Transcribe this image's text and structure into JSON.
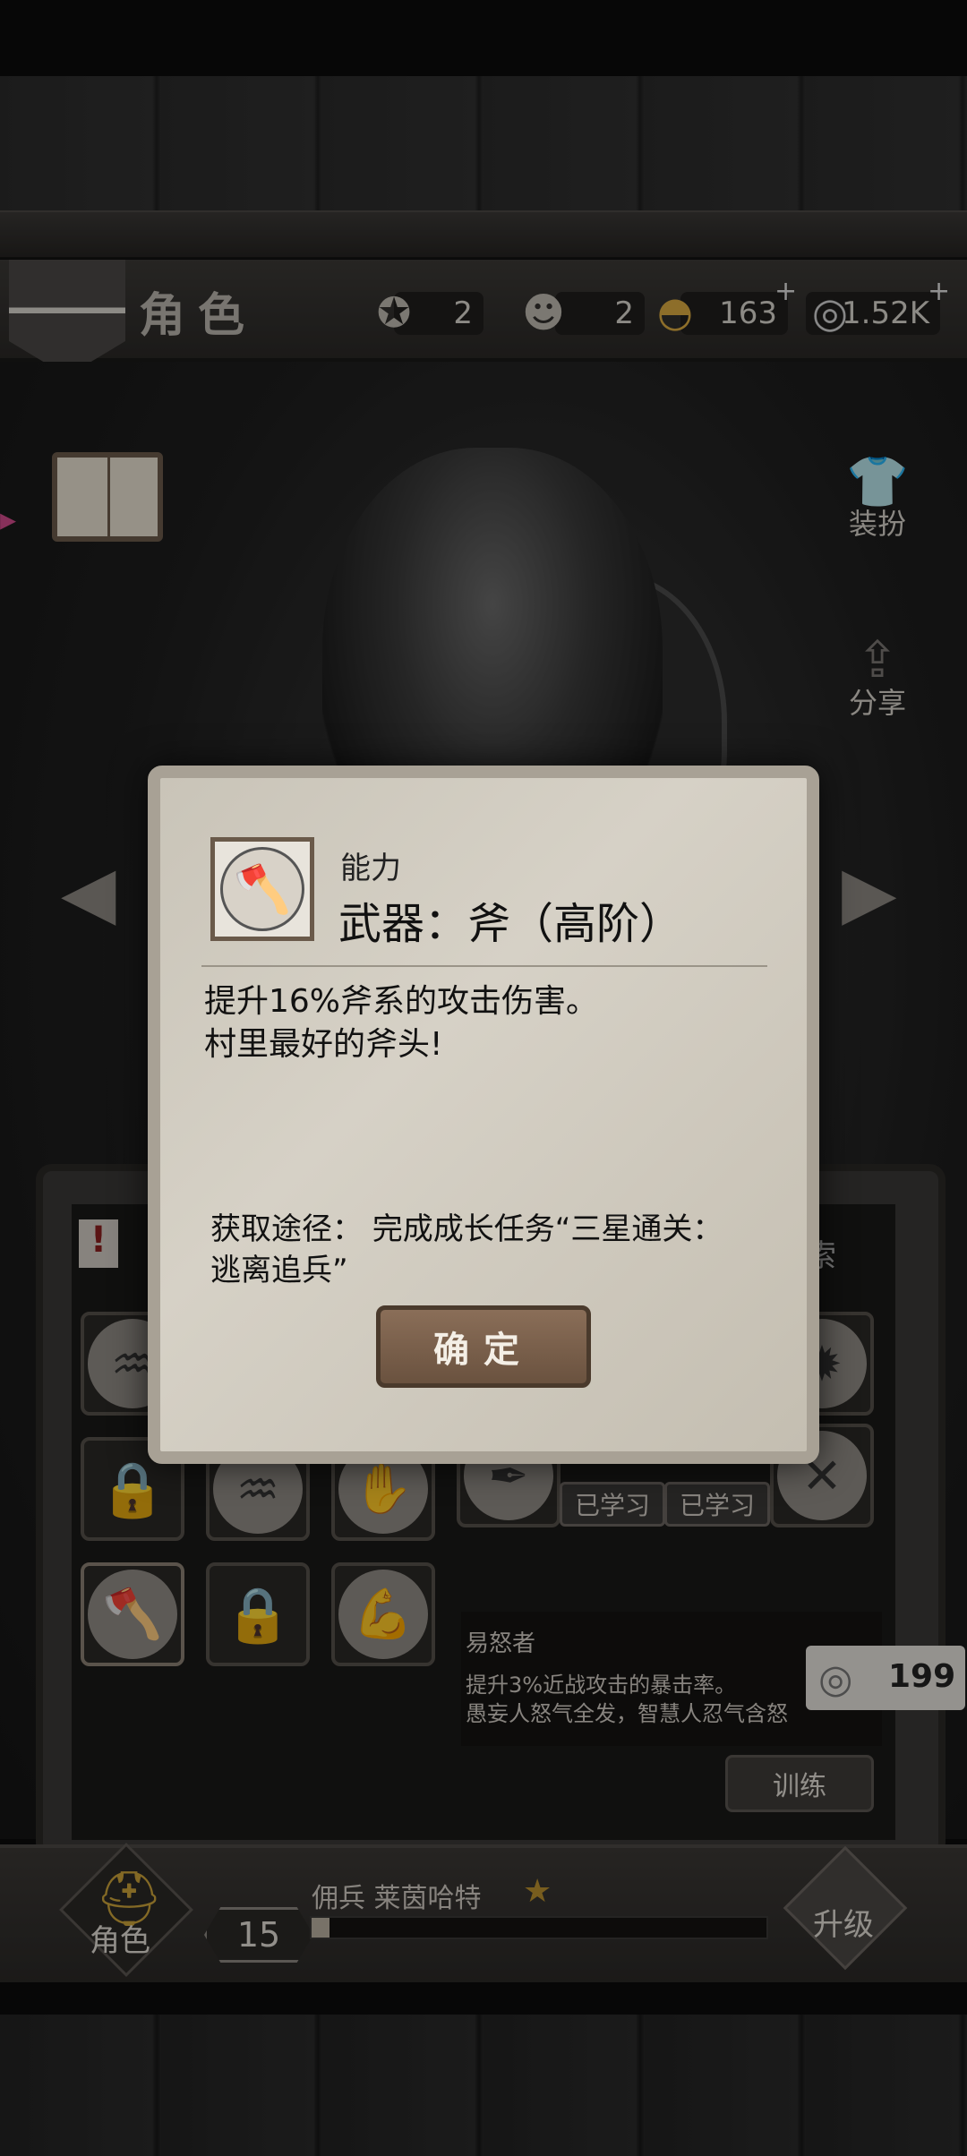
{
  "header": {
    "title": "角色",
    "resources": [
      {
        "icon": "puzzle-emblem-icon",
        "value": "2"
      },
      {
        "icon": "puzzle-portrait-icon",
        "value": "2"
      },
      {
        "icon": "shell-icon",
        "value": "163",
        "plus": "+"
      },
      {
        "icon": "coin-icon",
        "value": "1.52K",
        "plus": "+"
      }
    ]
  },
  "side_actions": {
    "outfit_label": "装扮",
    "share_label": "分享"
  },
  "skills": {
    "learned_label": "已学习",
    "search_partial": "索",
    "selected_skill_name": "易怒者",
    "selected_skill_desc_1": "提升3%近战攻击的暴击率。",
    "selected_skill_desc_2": "愚妄人怒气全发，智慧人忍气含怒",
    "train_label": "训练",
    "train_cost": "199"
  },
  "bottom": {
    "role_label": "角色",
    "level": "15",
    "character_name": "佣兵 莱茵哈特",
    "upgrade_label": "升级"
  },
  "dialog": {
    "type": "能力",
    "name": "武器：斧（高阶）",
    "desc_line1": "提升16%斧系的攻击伤害。",
    "desc_line2": "村里最好的斧头!",
    "source": "获取途径： 完成成长任务“三星通关：逃离追兵”",
    "confirm_label": "确定"
  }
}
